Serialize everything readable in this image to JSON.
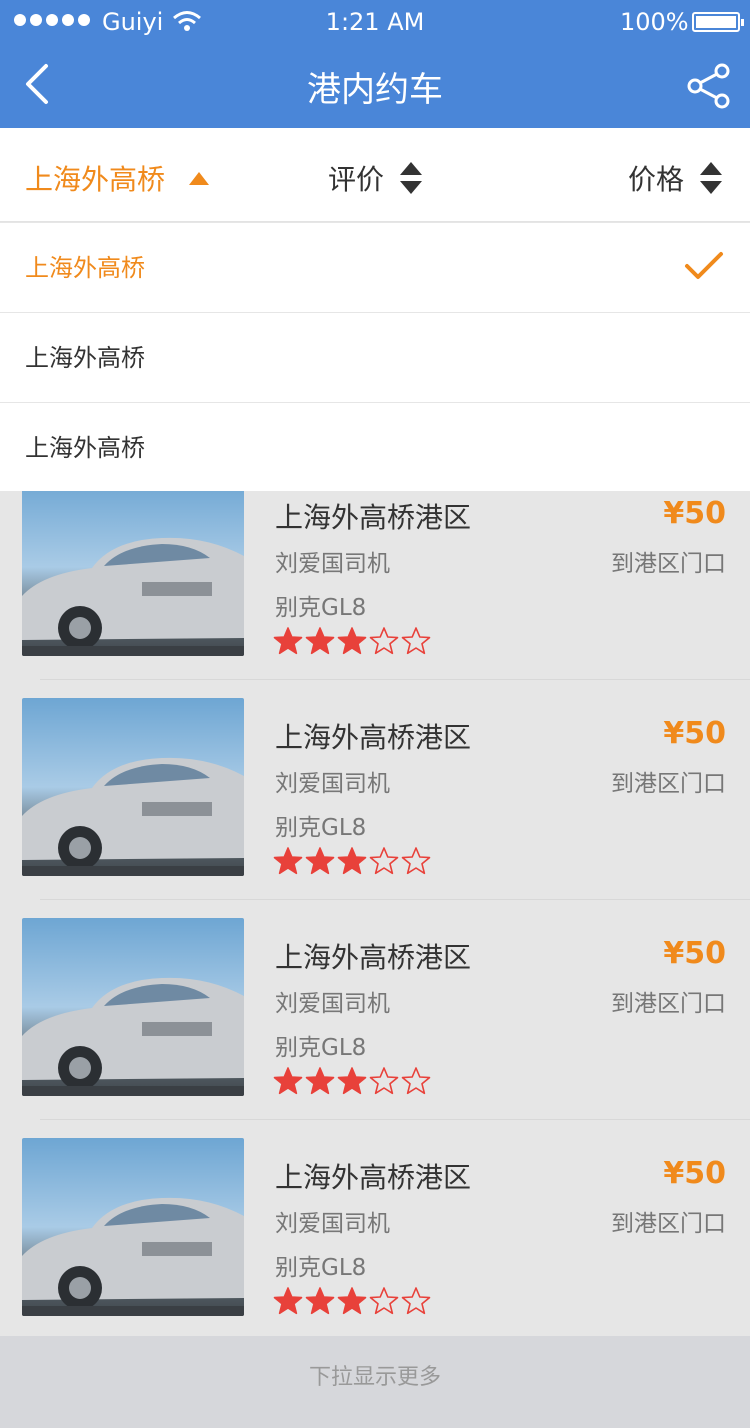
{
  "status_bar": {
    "carrier": "Guiyi",
    "time": "1:21 AM",
    "battery": "100%"
  },
  "nav": {
    "title": "港内约车"
  },
  "filters": [
    {
      "label": "上海外高桥",
      "active": true
    },
    {
      "label": "评价",
      "active": false
    },
    {
      "label": "价格",
      "active": false
    }
  ],
  "dropdown": {
    "options": [
      {
        "label": "上海外高桥",
        "selected": true
      },
      {
        "label": "上海外高桥",
        "selected": false
      },
      {
        "label": "上海外高桥",
        "selected": false
      }
    ]
  },
  "list": {
    "items": [
      {
        "name": "上海外高桥港区",
        "price": "¥50",
        "driver": "刘爱国司机",
        "destination": "到港区门口",
        "model": "别克GL8",
        "rating": 3,
        "rating_max": 5
      },
      {
        "name": "上海外高桥港区",
        "price": "¥50",
        "driver": "刘爱国司机",
        "destination": "到港区门口",
        "model": "别克GL8",
        "rating": 3,
        "rating_max": 5
      },
      {
        "name": "上海外高桥港区",
        "price": "¥50",
        "driver": "刘爱国司机",
        "destination": "到港区门口",
        "model": "别克GL8",
        "rating": 3,
        "rating_max": 5
      },
      {
        "name": "上海外高桥港区",
        "price": "¥50",
        "driver": "刘爱国司机",
        "destination": "到港区门口",
        "model": "别克GL8",
        "rating": 3,
        "rating_max": 5
      }
    ]
  },
  "footer": {
    "text": "下拉显示更多"
  },
  "colors": {
    "nav_bg": "#4a86d8",
    "accent": "#f08a1c",
    "star": "#e8413a"
  }
}
